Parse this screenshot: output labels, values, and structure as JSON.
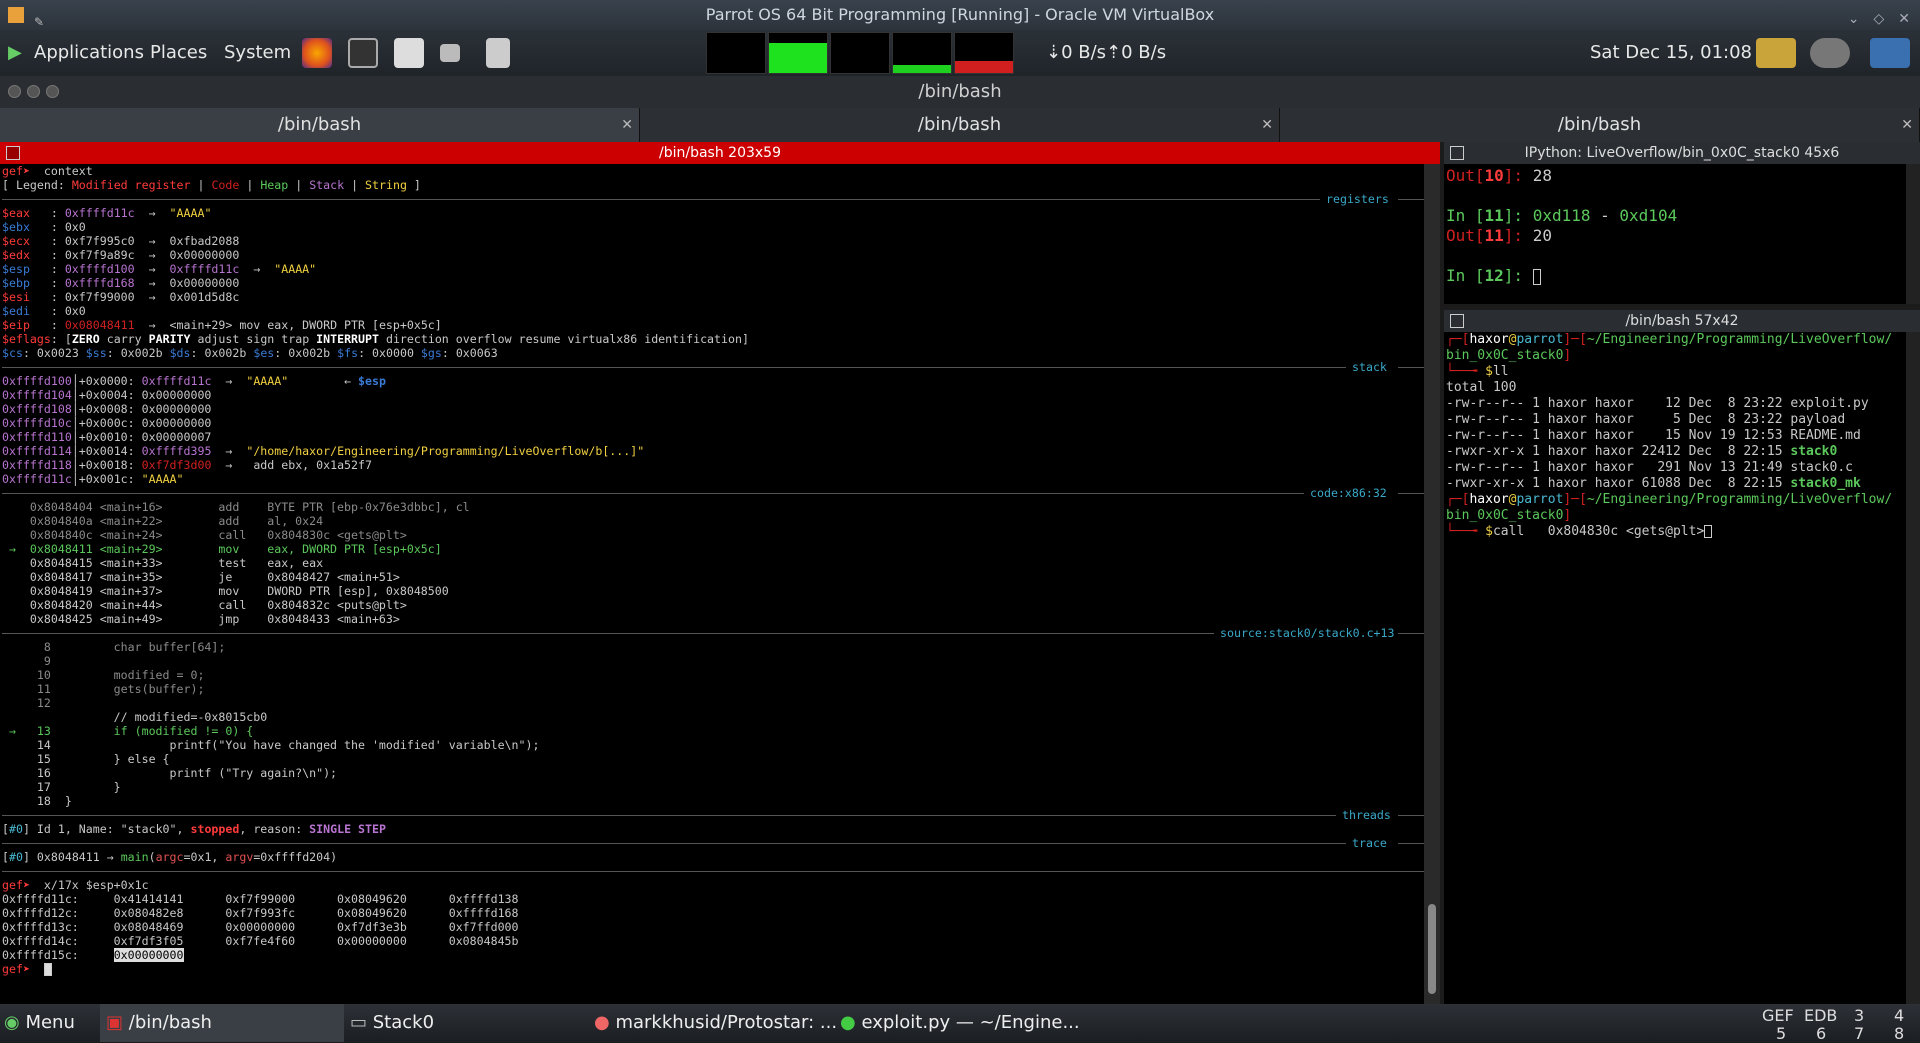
{
  "vbox": {
    "title": "Parrot OS 64 Bit Programming [Running] - Oracle VM VirtualBox"
  },
  "panel": {
    "applications": "Applications",
    "places": "Places",
    "system": "System",
    "net": "⇣0 B/s⇡0 B/s",
    "clock": "Sat Dec 15, 01:08"
  },
  "window": {
    "title": "/bin/bash"
  },
  "tabs": [
    "/bin/bash",
    "/bin/bash",
    "/bin/bash"
  ],
  "left_header": "/bin/bash 203x59",
  "left_lines": [
    "gef➤  context",
    "[ Legend: Modified register | Code | Heap | Stack | String ]",
    "$eax   : 0xffffd11c  →  \"AAAA\"",
    "$ebx   : 0x0",
    "$ecx   : 0xf7f995c0  →  0xfbad2088",
    "$edx   : 0xf7f9a89c  →  0x00000000",
    "$esp   : 0xffffd100  →  0xffffd11c  →  \"AAAA\"",
    "$ebp   : 0xffffd168  →  0x00000000",
    "$esi   : 0xf7f99000  →  0x001d5d8c",
    "$edi   : 0x0",
    "$eip   : 0x08048411  →  <main+29> mov eax, DWORD PTR [esp+0x5c]",
    "$eflags: [ZERO carry PARITY adjust sign trap INTERRUPT direction overflow resume virtualx86 identification]",
    "$cs: 0x0023 $ss: 0x002b $ds: 0x002b $es: 0x002b $fs: 0x0000 $gs: 0x0063",
    "0xffffd100│+0x0000: 0xffffd11c  →  \"AAAA\"        ← $esp",
    "0xffffd104│+0x0004: 0x00000000",
    "0xffffd108│+0x0008: 0x00000000",
    "0xffffd10c│+0x000c: 0x00000000",
    "0xffffd110│+0x0010: 0x00000007",
    "0xffffd114│+0x0014: 0xffffd395  →  \"/home/haxor/Engineering/Programming/LiveOverflow/b[...]\"",
    "0xffffd118│+0x0018: 0xf7df3d00  →   add ebx, 0x1a52f7",
    "0xffffd11c│+0x001c: \"AAAA\"",
    "    0x8048404 <main+16>        add    BYTE PTR [ebp-0x76e3dbbc], cl",
    "    0x804840a <main+22>        add    al, 0x24",
    "    0x804840c <main+24>        call   0x804830c <gets@plt>",
    " →  0x8048411 <main+29>        mov    eax, DWORD PTR [esp+0x5c]",
    "    0x8048415 <main+33>        test   eax, eax",
    "    0x8048417 <main+35>        je     0x8048427 <main+51>",
    "    0x8048419 <main+37>        mov    DWORD PTR [esp], 0x8048500",
    "    0x8048420 <main+44>        call   0x804832c <puts@plt>",
    "    0x8048425 <main+49>        jmp    0x8048433 <main+63>",
    "      8         char buffer[64];",
    "      9",
    "     10         modified = 0;",
    "     11         gets(buffer);",
    "     12",
    "                // modified=-0x8015cb0",
    " →   13         if (modified != 0) {",
    "     14                 printf(\"You have changed the 'modified' variable\\n\");",
    "     15         } else {",
    "     16                 printf (\"Try again?\\n\");",
    "     17         }",
    "     18  }",
    "[#0] Id 1, Name: \"stack0\", stopped, reason: SINGLE STEP",
    "[#0] 0x8048411 → main(argc=0x1, argv=0xffffd204)",
    "gef➤  x/17x $esp+0x1c",
    "0xffffd11c:     0x41414141      0xf7f99000      0x08049620      0xffffd138",
    "0xffffd12c:     0x080482e8      0xf7f993fc      0x08049620      0xffffd168",
    "0xffffd13c:     0x08048469      0x00000000      0xf7df3e3b      0xf7ffd000",
    "0xffffd14c:     0xf7df3f05      0xf7fe4f60      0x00000000      0x0804845b",
    "0xffffd15c:     0x00000000",
    "gef➤  "
  ],
  "sep_labels": {
    "registers": "registers",
    "stack": "stack",
    "code": "code:x86:32",
    "source": "source:stack0/stack0.c+13",
    "threads": "threads",
    "trace": "trace"
  },
  "ipython": {
    "header": "IPython: LiveOverflow/bin_0x0C_stack0 45x6",
    "lines": [
      "Out[10]: 28",
      "",
      "In [11]: 0xd118 - 0xd104",
      "Out[11]: 20",
      "",
      "In [12]: "
    ]
  },
  "bash2": {
    "header": "/bin/bash 57x42",
    "lines": [
      "┌─[haxor@parrot]─[~/Engineering/Programming/LiveOverflow/",
      "bin_0x0C_stack0]",
      "└──╼ $ll",
      "total 100",
      "-rw-r--r-- 1 haxor haxor    12 Dec  8 23:22 exploit.py",
      "-rw-r--r-- 1 haxor haxor     5 Dec  8 23:22 payload",
      "-rw-r--r-- 1 haxor haxor    15 Nov 19 12:53 README.md",
      "-rwxr-xr-x 1 haxor haxor 22412 Dec  8 22:15 stack0",
      "-rw-r--r-- 1 haxor haxor   291 Nov 13 21:49 stack0.c",
      "-rwxr-xr-x 1 haxor haxor 61088 Dec  8 22:15 stack0_mk",
      "┌─[haxor@parrot]─[~/Engineering/Programming/LiveOverflow/",
      "bin_0x0C_stack0]",
      "└──╼ $call   0x804830c <gets@plt>"
    ]
  },
  "taskbar": {
    "menu": "Menu",
    "items": [
      "/bin/bash",
      "Stack0",
      "markkhusid/Protostar: ...",
      "exploit.py — ~/Engine..."
    ],
    "workspaces": {
      "labels": [
        "GEF",
        "EDB",
        "3",
        "4"
      ],
      "nums": [
        "5",
        "6",
        "7",
        "8"
      ]
    }
  }
}
